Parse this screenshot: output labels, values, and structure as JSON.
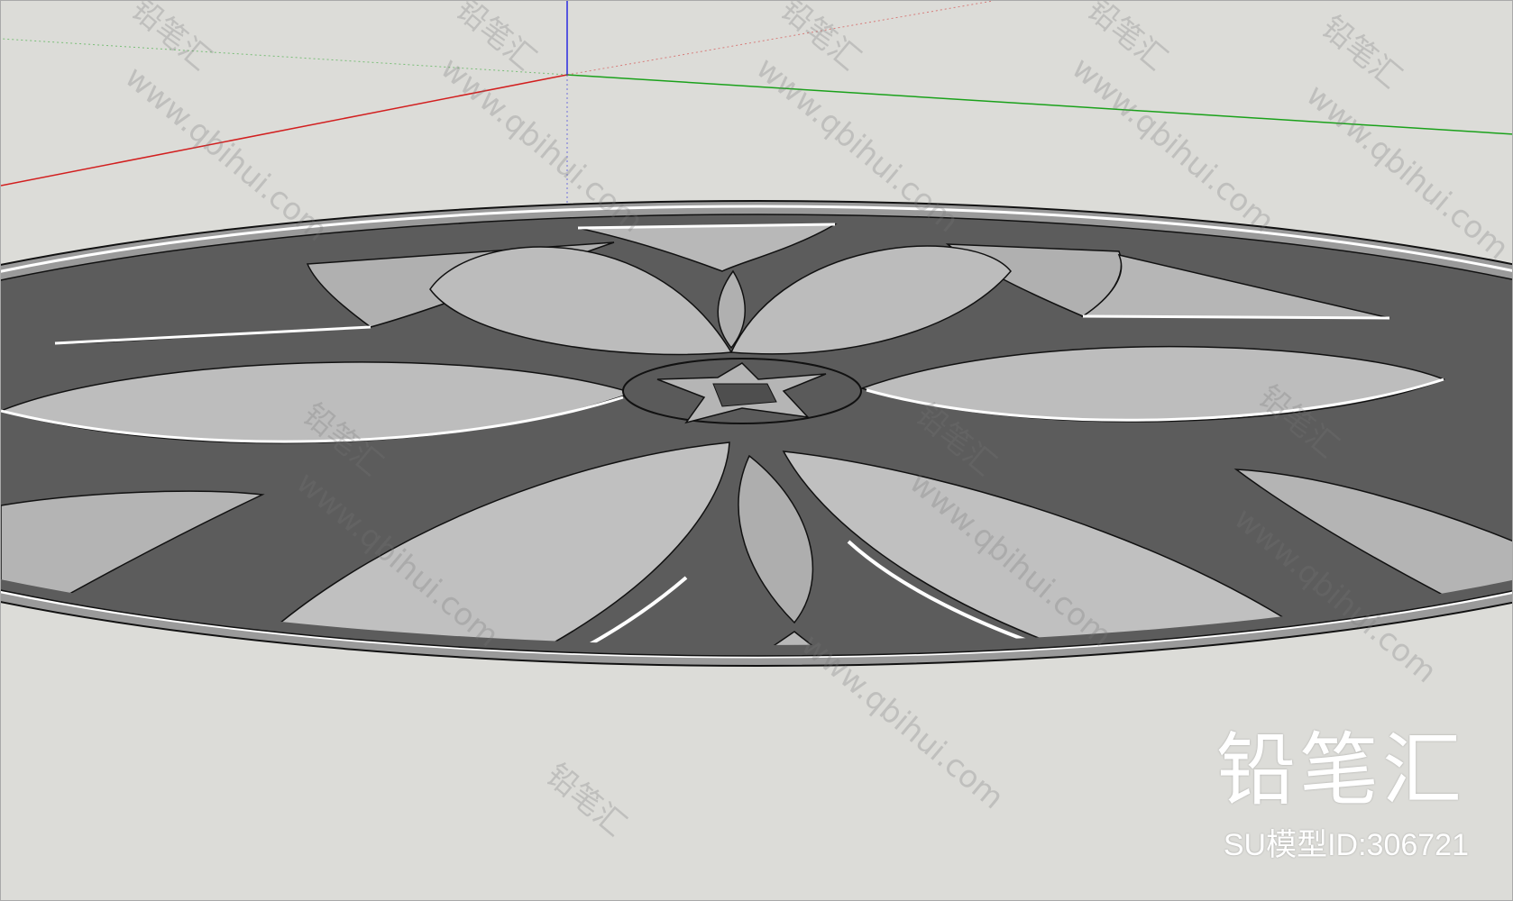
{
  "watermark": {
    "brand_text": "铅笔汇",
    "url_text": "www.qbihui.com"
  },
  "overlay": {
    "brand": "铅笔汇",
    "model_id": "SU模型ID:306721"
  },
  "colors": {
    "background": "#dcdcd8",
    "axis_red": "#d21f1f",
    "axis_green": "#1aa11a",
    "axis_blue": "#2a2ae0",
    "dark_stone": "#5c5c5c",
    "light_stone": "#b8b8b8",
    "edge": "#111111",
    "highlight": "#ffffff"
  },
  "icons": {
    "axis_origin": "axes-origin-icon"
  }
}
